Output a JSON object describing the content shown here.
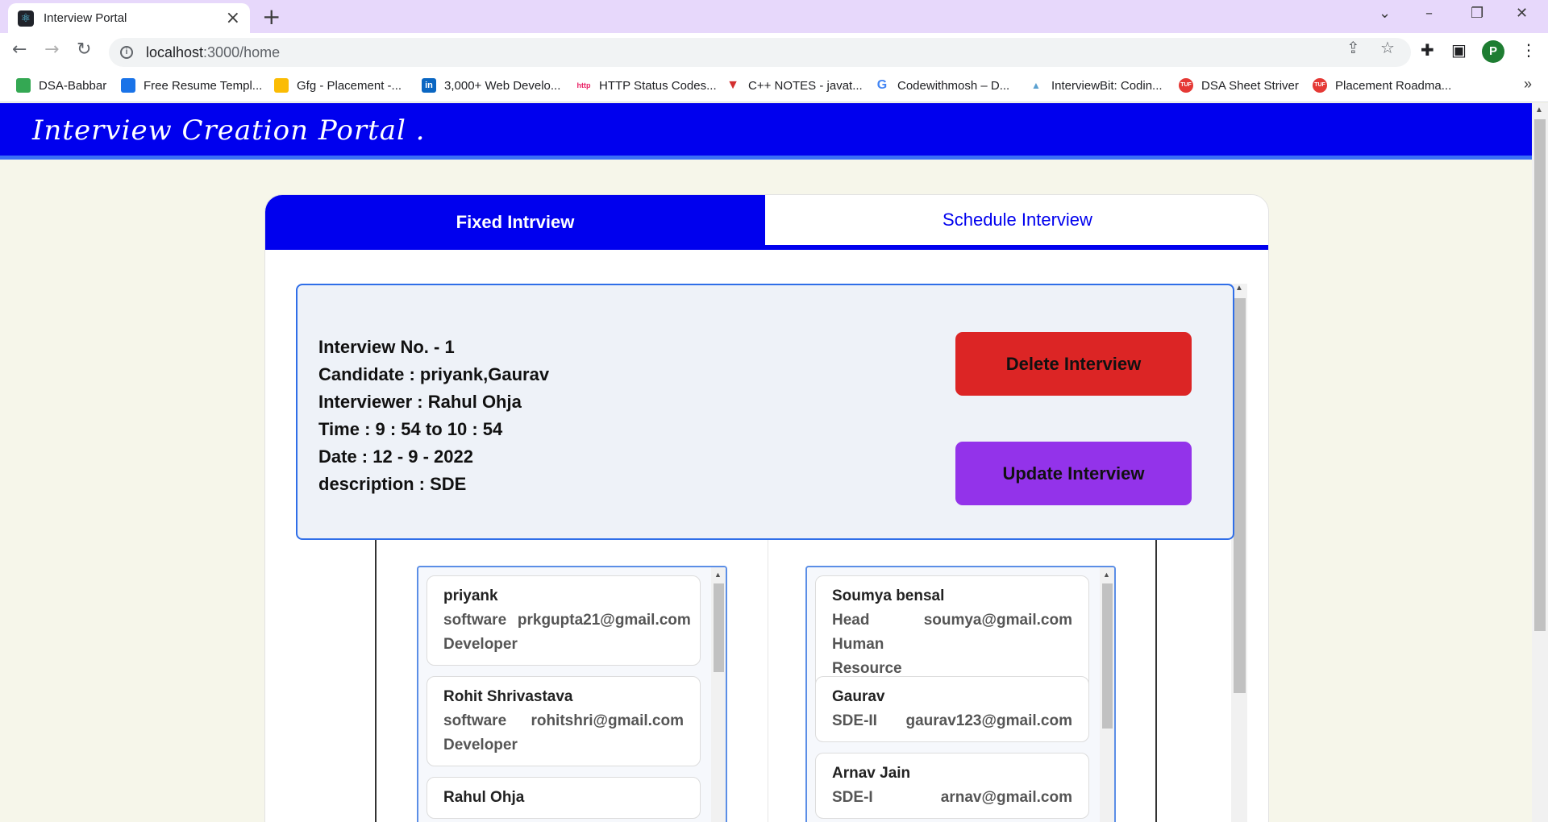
{
  "browser": {
    "tab_title": "Interview Portal",
    "url_host": "localhost",
    "url_rest": ":3000/home",
    "profile_initial": "P",
    "bookmarks": [
      {
        "label": "DSA-Babbar",
        "color": "#34a853"
      },
      {
        "label": "Free Resume Templ...",
        "color": "#1a73e8"
      },
      {
        "label": "Gfg - Placement -...",
        "color": "#fbbc04"
      },
      {
        "label": "3,000+ Web Develo...",
        "color": "#0a66c2"
      },
      {
        "label": "HTTP Status Codes...",
        "color": "#e91e63"
      },
      {
        "label": "C++ NOTES - javat...",
        "color": "#d32f2f"
      },
      {
        "label": "Codewithmosh – D...",
        "color": "#4285f4"
      },
      {
        "label": "InterviewBit: Codin...",
        "color": "#5aa0d0"
      },
      {
        "label": "DSA Sheet Striver",
        "color": "#e53935"
      },
      {
        "label": "Placement Roadma...",
        "color": "#e53935"
      }
    ]
  },
  "app": {
    "brand": "Interview Creation Portal .",
    "tabs": [
      "Fixed Intrview",
      "Schedule Interview"
    ],
    "interview": {
      "number": "Interview No. - 1",
      "candidate": "Candidate : priyank,Gaurav",
      "interviewer": "Interviewer : Rahul Ohja",
      "time": "Time : 9 : 54 to 10 : 54",
      "date": "Date : 12 - 9 - 2022",
      "description": "description : SDE"
    },
    "buttons": {
      "delete": "Delete Interview",
      "update": "Update Interview"
    },
    "left_people": [
      {
        "name": "priyank",
        "role": "software Developer",
        "email": "prkgupta21@gmail.com"
      },
      {
        "name": "Rohit Shrivastava",
        "role": "software Developer",
        "email": "rohitshri@gmail.com"
      },
      {
        "name": "Rahul Ohja",
        "role": "",
        "email": ""
      }
    ],
    "right_people": [
      {
        "name": "Soumya bensal",
        "role": "Head Human Resource",
        "email": "soumya@gmail.com"
      },
      {
        "name": "Gaurav",
        "role": "SDE-II",
        "email": "gaurav123@gmail.com"
      },
      {
        "name": "Arnav Jain",
        "role": "SDE-I",
        "email": "arnav@gmail.com"
      }
    ]
  },
  "colors": {
    "header": "#0000ee",
    "delete": "#dc2525",
    "update": "#9333ea"
  },
  "icons": [
    "react-icon",
    "close-icon",
    "plus-icon",
    "back-icon",
    "forward-icon",
    "reload-icon",
    "info-icon",
    "share-icon",
    "star-icon",
    "puzzle-icon",
    "sidepanel-icon",
    "menu-icon",
    "chevron-down-icon",
    "minimize-icon",
    "restore-icon"
  ]
}
